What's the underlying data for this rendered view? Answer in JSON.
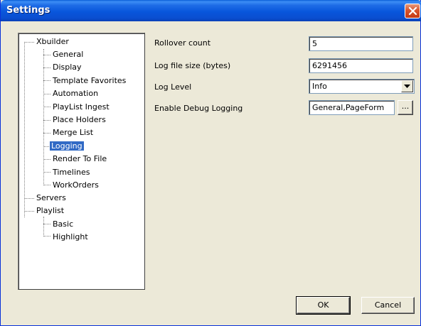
{
  "window": {
    "title": "Settings"
  },
  "tree": {
    "items": [
      {
        "label": "Xbuilder",
        "level": 0,
        "selected": false
      },
      {
        "label": "General",
        "level": 1,
        "selected": false
      },
      {
        "label": "Display",
        "level": 1,
        "selected": false
      },
      {
        "label": "Template Favorites",
        "level": 1,
        "selected": false
      },
      {
        "label": "Automation",
        "level": 1,
        "selected": false
      },
      {
        "label": "PlayList Ingest",
        "level": 1,
        "selected": false
      },
      {
        "label": "Place Holders",
        "level": 1,
        "selected": false
      },
      {
        "label": "Merge List",
        "level": 1,
        "selected": false
      },
      {
        "label": "Logging",
        "level": 1,
        "selected": true
      },
      {
        "label": "Render To File",
        "level": 1,
        "selected": false
      },
      {
        "label": "Timelines",
        "level": 1,
        "selected": false
      },
      {
        "label": "WorkOrders",
        "level": 1,
        "selected": false
      },
      {
        "label": "Servers",
        "level": 0,
        "selected": false
      },
      {
        "label": "Playlist",
        "level": 0,
        "selected": false
      },
      {
        "label": "Basic",
        "level": 1,
        "selected": false
      },
      {
        "label": "Highlight",
        "level": 1,
        "selected": false
      }
    ]
  },
  "settings": {
    "rollover_count": {
      "label": "Rollover count",
      "value": "5"
    },
    "log_file_size": {
      "label": "Log file size (bytes)",
      "value": "6291456"
    },
    "log_level": {
      "label": "Log Level",
      "value": "Info"
    },
    "debug_logging": {
      "label": "Enable Debug Logging",
      "value": "General,PageForm",
      "browse_label": "..."
    }
  },
  "buttons": {
    "ok": "OK",
    "cancel": "Cancel"
  }
}
